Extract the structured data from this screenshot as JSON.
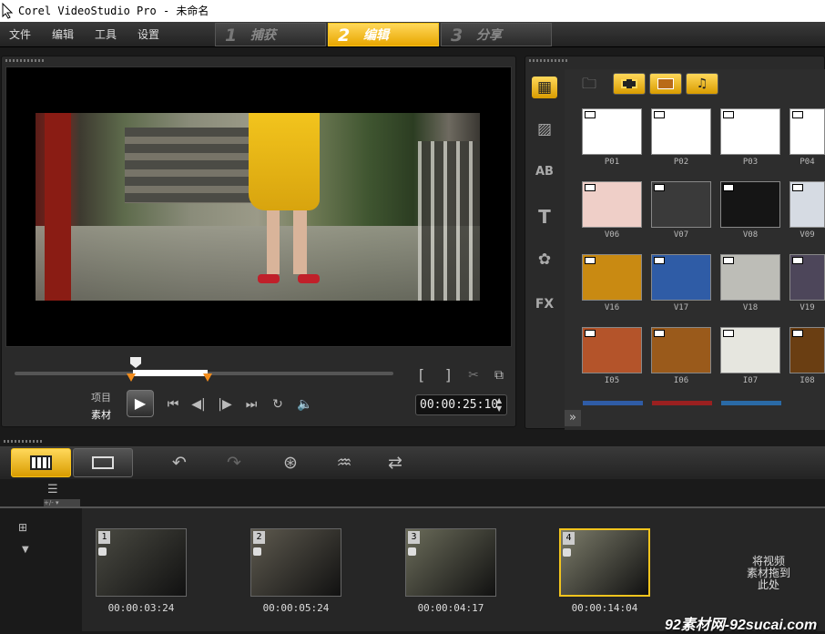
{
  "window": {
    "title": "Corel VideoStudio Pro - 未命名"
  },
  "menu": [
    "文件",
    "编辑",
    "工具",
    "设置"
  ],
  "steps": [
    {
      "num": "1",
      "label": "捕获"
    },
    {
      "num": "2",
      "label": "编辑",
      "active": true
    },
    {
      "num": "3",
      "label": "分享"
    }
  ],
  "player": {
    "mode_project": "项目",
    "mode_clip": "素材",
    "timecode": "00:00:25:10",
    "trim_in": "[",
    "trim_out": "]"
  },
  "library": {
    "thumbnails": [
      {
        "label": "P01",
        "color": "#ffffff"
      },
      {
        "label": "P02",
        "color": "#ffffff"
      },
      {
        "label": "P03",
        "color": "#ffffff"
      },
      {
        "label": "P04",
        "color": "#ffffff"
      },
      {
        "label": "V06",
        "color": "#efcfc8"
      },
      {
        "label": "V07",
        "color": "#3a3a3a"
      },
      {
        "label": "V08",
        "color": "#151515"
      },
      {
        "label": "V09",
        "color": "#d6dbe3"
      },
      {
        "label": "V16",
        "color": "#c98a12"
      },
      {
        "label": "V17",
        "color": "#2f5ca6"
      },
      {
        "label": "V18",
        "color": "#bdbdb7"
      },
      {
        "label": "V19",
        "color": "#4d465a"
      },
      {
        "label": "I05",
        "color": "#b4542a"
      },
      {
        "label": "I06",
        "color": "#9a5a1b"
      },
      {
        "label": "I07",
        "color": "#e6e6df"
      },
      {
        "label": "I08",
        "color": "#6a3e12"
      }
    ],
    "expand_icon": "»"
  },
  "storyboard": {
    "clips": [
      {
        "num": "1",
        "time": "00:00:03:24",
        "color": "#4a4a42"
      },
      {
        "num": "2",
        "time": "00:00:05:24",
        "color": "#5e5a4f"
      },
      {
        "num": "3",
        "time": "00:00:04:17",
        "color": "#6b6c5a"
      },
      {
        "num": "4",
        "time": "00:00:14:04",
        "color": "#7c7c6a",
        "selected": true
      }
    ],
    "drop_hint": "将视频\n素材拖到\n此处"
  },
  "watermark": "92素材网-92sucai.com",
  "colors": {
    "accent": "#f7c21a"
  }
}
